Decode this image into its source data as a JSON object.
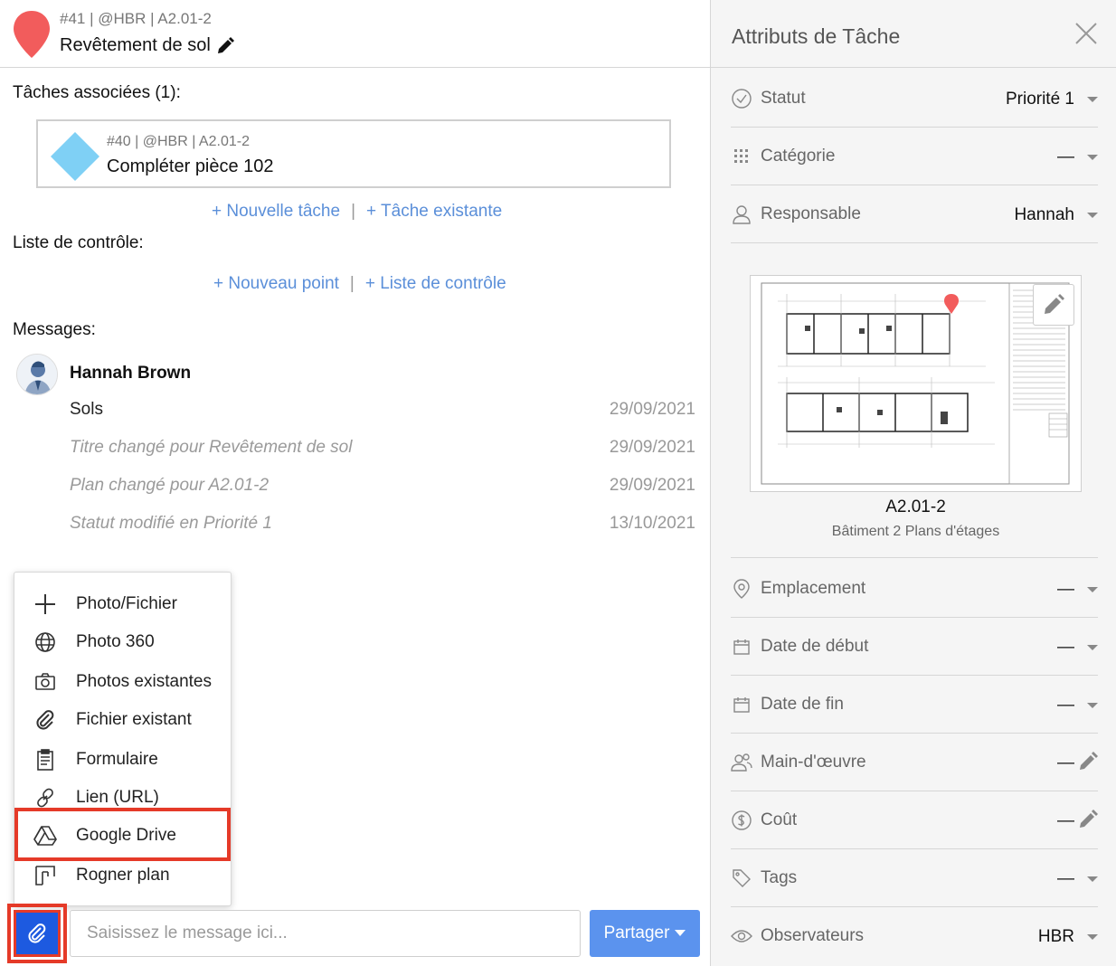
{
  "task": {
    "meta": "#41 | @HBR | A2.01-2",
    "title": "Revêtement de sol"
  },
  "related": {
    "label": "Tâches associées (1):",
    "card": {
      "meta": "#40 | @HBR | A2.01-2",
      "title": "Compléter pièce 102"
    },
    "new_task": "+ Nouvelle tâche",
    "existing_task": "+ Tâche existante",
    "separator": "|"
  },
  "checklist": {
    "label": "Liste de contrôle:",
    "new_point": "+ Nouveau point",
    "checklist_link": "+ Liste de contrôle",
    "separator": "|"
  },
  "messages": {
    "label": "Messages:",
    "author": "Hannah Brown",
    "items": [
      {
        "text": "Sols",
        "date": "29/09/2021"
      },
      {
        "text": "Titre changé pour Revêtement de sol",
        "date": "29/09/2021"
      },
      {
        "text": "Plan changé pour A2.01-2",
        "date": "29/09/2021"
      },
      {
        "text": "Statut modifié en Priorité 1",
        "date": "13/10/2021"
      }
    ]
  },
  "attach_menu": {
    "items": [
      {
        "label": "Photo/Fichier",
        "icon": "plus-icon"
      },
      {
        "label": "Photo 360",
        "icon": "globe-icon"
      },
      {
        "label": "Photos existantes",
        "icon": "camera-icon"
      },
      {
        "label": "Fichier existant",
        "icon": "paperclip-icon"
      },
      {
        "label": "Formulaire",
        "icon": "clipboard-icon"
      },
      {
        "label": "Lien (URL)",
        "icon": "link-icon"
      },
      {
        "label": "Google Drive",
        "icon": "google-drive-icon"
      },
      {
        "label": "Rogner plan",
        "icon": "crop-plan-icon"
      }
    ],
    "highlighted": "Google Drive"
  },
  "composer": {
    "placeholder": "Saisissez le message ici...",
    "share_label": "Partager"
  },
  "attributes": {
    "title": "Attributs de Tâche",
    "rows_top": [
      {
        "label": "Statut",
        "value": "Priorité 1",
        "icon": "check-circle-icon",
        "control": "caret"
      },
      {
        "label": "Catégorie",
        "value": "—",
        "icon": "grid-dots-icon",
        "control": "caret"
      },
      {
        "label": "Responsable",
        "value": "Hannah",
        "icon": "user-icon",
        "control": "caret"
      }
    ],
    "plan": {
      "name": "A2.01-2",
      "description": "Bâtiment 2 Plans d'étages"
    },
    "rows_bottom": [
      {
        "label": "Emplacement",
        "value": "—",
        "icon": "location-pin-icon",
        "control": "caret"
      },
      {
        "label": "Date de début",
        "value": "—",
        "icon": "calendar-icon",
        "control": "caret"
      },
      {
        "label": "Date de fin",
        "value": "—",
        "icon": "calendar-icon",
        "control": "caret"
      },
      {
        "label": "Main-d'œuvre",
        "value": "—",
        "icon": "workers-icon",
        "control": "pencil"
      },
      {
        "label": "Coût",
        "value": "—",
        "icon": "dollar-circle-icon",
        "control": "pencil"
      },
      {
        "label": "Tags",
        "value": "—",
        "icon": "tag-icon",
        "control": "caret"
      },
      {
        "label": "Observateurs",
        "value": "HBR",
        "icon": "eye-icon",
        "control": "caret"
      }
    ]
  },
  "colors": {
    "pin_red": "#f25c5c",
    "diamond_blue": "#7fd0f5",
    "link_blue": "#5b8fd9",
    "attach_blue": "#1d5ae0",
    "share_blue": "#5b93ee",
    "highlight_red": "#e53a28"
  }
}
